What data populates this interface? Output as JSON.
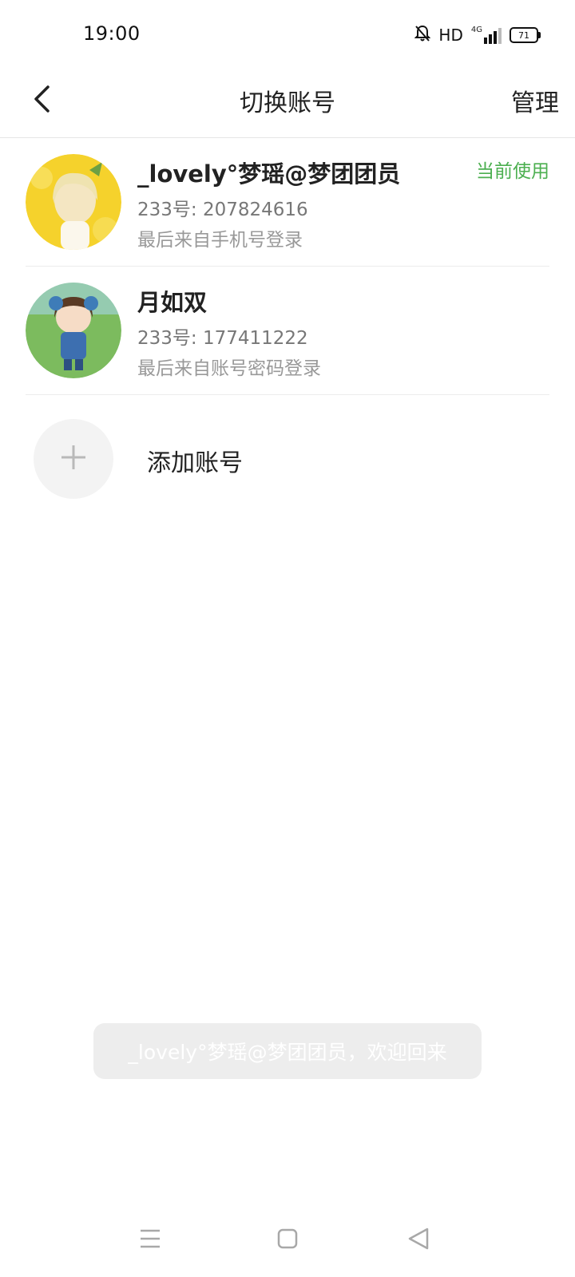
{
  "status_bar": {
    "time": "19:00",
    "hd_label": "HD",
    "network_label": "4G",
    "battery_level": "71",
    "icons": [
      "bell-muted-icon",
      "signal-icon",
      "battery-icon"
    ]
  },
  "header": {
    "title": "切换账号",
    "manage_label": "管理",
    "back_icon": "chevron-left-icon"
  },
  "accounts": [
    {
      "name": "_lovely°梦瑶@梦团团员",
      "id_line": "233号: 207824616",
      "login_line": "最后来自手机号登录",
      "badge": "当前使用",
      "avatar_colors": [
        "#f7d52a",
        "#f0c419"
      ]
    },
    {
      "name": "月如双",
      "id_line": "233号: 177411222",
      "login_line": "最后来自账号密码登录",
      "badge": "",
      "avatar_colors": [
        "#8cc46e",
        "#5fa24a"
      ]
    }
  ],
  "add_account": {
    "label": "添加账号",
    "icon": "plus-icon"
  },
  "toast": {
    "message": "_lovely°梦瑶@梦团团员，欢迎回来"
  },
  "nav_bar": {
    "icons": [
      "menu-icon",
      "home-square-icon",
      "back-triangle-icon"
    ]
  },
  "colors": {
    "accent_green": "#4caf50",
    "divider": "#ececec",
    "toast_bg": "#ededed"
  }
}
